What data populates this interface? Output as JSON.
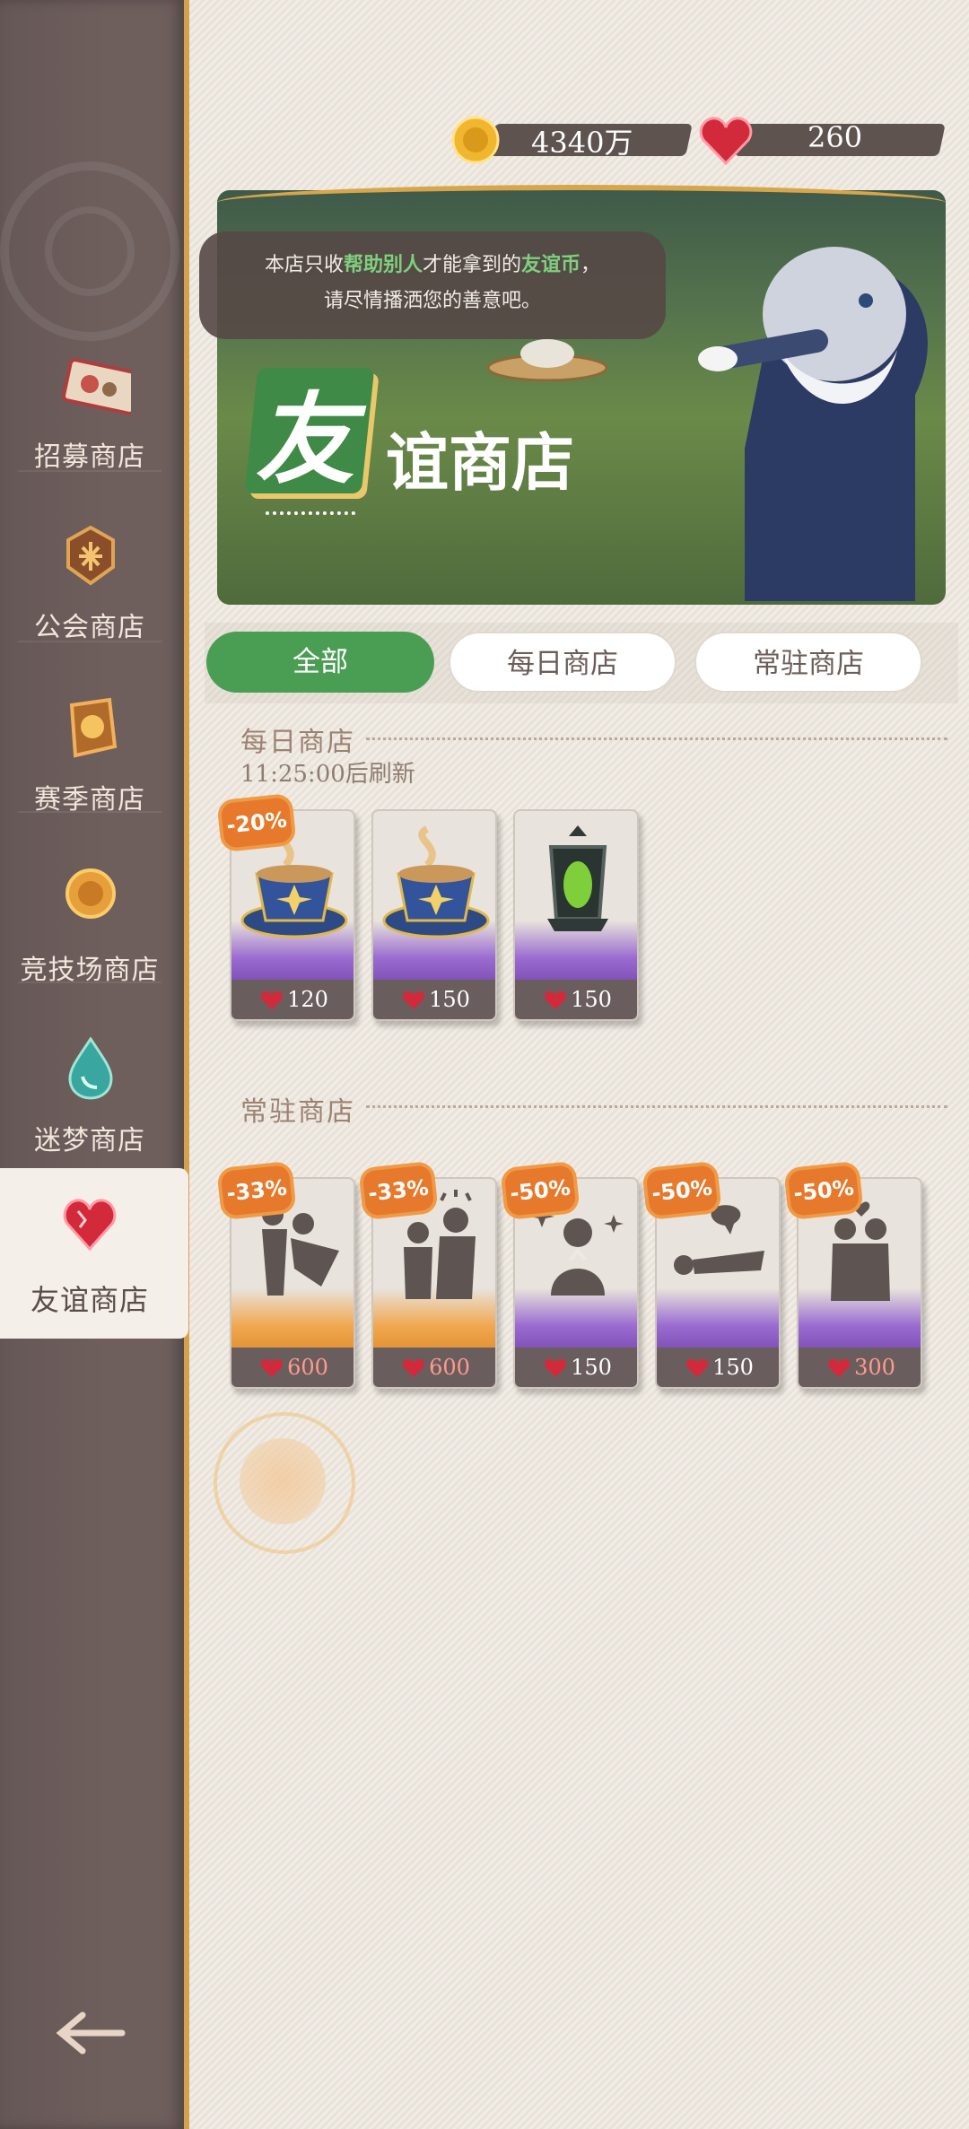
{
  "sidebar": {
    "items": [
      {
        "label": "招募商店",
        "icon": "recruit-ticket-icon"
      },
      {
        "label": "公会商店",
        "icon": "guild-badge-icon"
      },
      {
        "label": "赛季商店",
        "icon": "season-medal-icon"
      },
      {
        "label": "竞技场商店",
        "icon": "arena-coin-icon"
      },
      {
        "label": "迷梦商店",
        "icon": "dream-drop-icon"
      },
      {
        "label": "友谊商店",
        "icon": "heart-gem-icon"
      }
    ],
    "active": "友谊商店",
    "back_icon": "back-arrow-icon"
  },
  "currency": {
    "gold": {
      "value": "4340万",
      "icon": "gold-coin-icon"
    },
    "friendship": {
      "value": "260",
      "icon": "heart-gem-icon"
    }
  },
  "banner": {
    "speech_part1": "本店只收",
    "speech_highlight1": "帮助别人",
    "speech_part2": "才能拿到的",
    "speech_highlight2": "友谊币",
    "speech_part3": "，",
    "speech_line2": "请尽情播洒您的善意吧。",
    "title_char": "友",
    "title_rest": "谊商店"
  },
  "tabs": [
    {
      "label": "全部",
      "selected": true
    },
    {
      "label": "每日商店",
      "selected": false
    },
    {
      "label": "常驻商店",
      "selected": false
    }
  ],
  "daily": {
    "title": "每日商店",
    "refresh": "11:25:00后刷新",
    "items": [
      {
        "name": "coffee-cup",
        "price": "120",
        "discount": "-20%"
      },
      {
        "name": "coffee-cup",
        "price": "150",
        "discount": ""
      },
      {
        "name": "green-lantern",
        "price": "150",
        "discount": ""
      }
    ]
  },
  "permanent": {
    "title": "常驻商店",
    "items": [
      {
        "name": "hug-gesture",
        "price": "600",
        "discount": "-33%"
      },
      {
        "name": "comfort-gesture",
        "price": "600",
        "discount": "-33%"
      },
      {
        "name": "pray-gesture",
        "price": "150",
        "discount": "-50%"
      },
      {
        "name": "lie-down-gesture",
        "price": "150",
        "discount": "-50%"
      },
      {
        "name": "embrace-heart-gesture",
        "price": "300",
        "discount": "-50%"
      }
    ]
  },
  "colors": {
    "accent_green": "#4a9e54",
    "sidebar": "#6e5f5d",
    "gold_trim": "#d3a24c",
    "badge_orange": "#e7792c"
  }
}
